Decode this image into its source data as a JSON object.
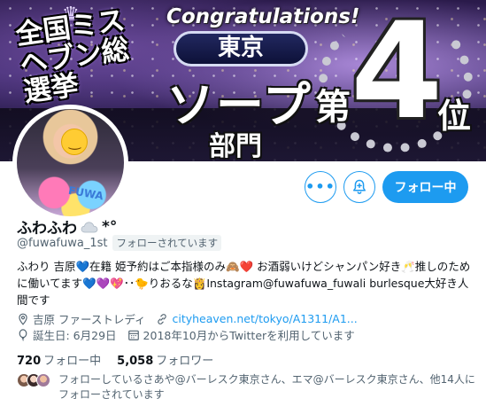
{
  "banner": {
    "award_title": "全国ミスヘブン総選挙",
    "congrats": "Congratulations!",
    "city": "東京",
    "category": "ソープ",
    "division": "部門",
    "rank_prefix": "第",
    "rank_number": "4",
    "rank_suffix": "位"
  },
  "avatar": {
    "wall_text": "FUWA"
  },
  "actions": {
    "more_icon": "more-horizontal-icon",
    "notify_icon": "bell-plus-icon",
    "follow_label": "フォロー中"
  },
  "profile": {
    "display_name": "ふわふわ",
    "name_suffix": "*°",
    "handle": "@fuwafuwa_1st",
    "follows_you": "フォローされています",
    "bio": "ふわり 吉原💙在籍 姫予約はご本指様のみ🙈❤️ お酒弱いけどシャンパン好き🥂推しのために働いてます💙💜💖･･🐤りおるな👸Instagram@fuwafuwa_fuwali burlesque大好き人間です"
  },
  "meta": {
    "location": "吉原 ファーストレディ",
    "url": "cityheaven.net/tokyo/A1311/A1...",
    "birthday": "誕生日: 6月29日",
    "joined": "2018年10月からTwitterを利用しています"
  },
  "stats": {
    "following_count": "720",
    "following_label": "フォロー中",
    "followers_count": "5,058",
    "followers_label": "フォロワー"
  },
  "known_followers": {
    "text": "フォローしているさあや@バーレスク東京さん、エマ@バーレスク東京さん、他14人にフォローされています"
  },
  "colors": {
    "accent": "#1d9bf0",
    "text_primary": "#0f1419",
    "text_secondary": "#536471"
  }
}
